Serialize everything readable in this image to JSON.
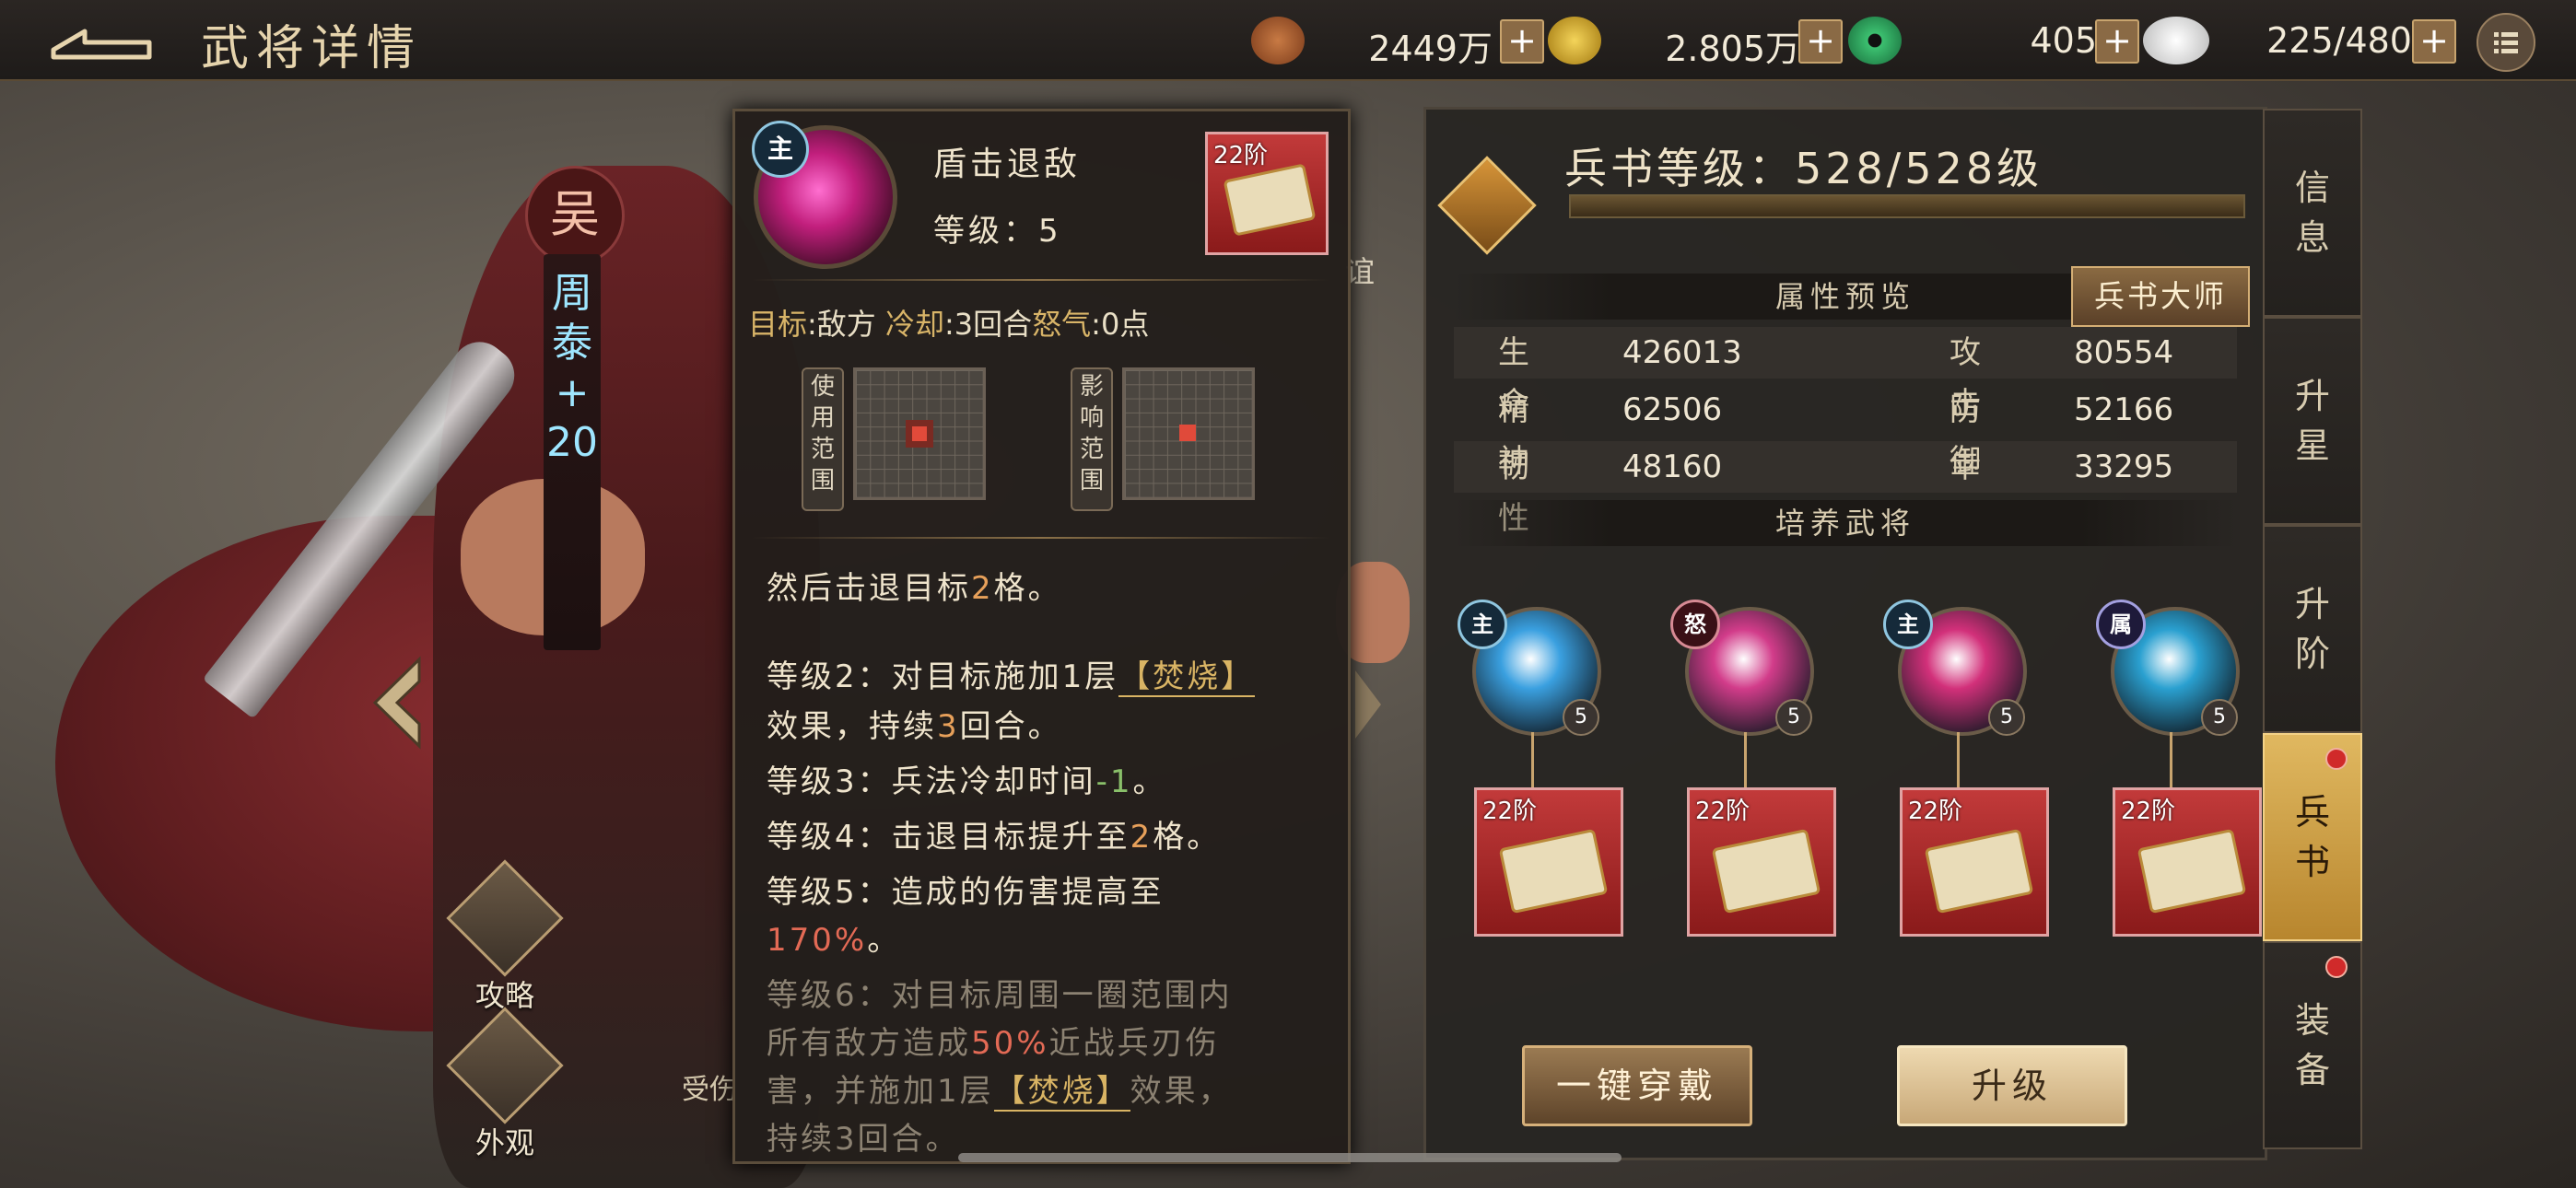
{
  "header": {
    "title": "武将详情",
    "resources": [
      {
        "icon": "copper-coin-icon",
        "value": "2449万"
      },
      {
        "icon": "gold-coin-icon",
        "value": "2.805万"
      },
      {
        "icon": "jade-icon",
        "value": "405"
      },
      {
        "icon": "steamed-bun-icon",
        "value": "225/480"
      }
    ],
    "plus_label": "+"
  },
  "hero": {
    "faction": "吴",
    "name_chars": [
      "周",
      "泰",
      "+",
      "20"
    ]
  },
  "side_buttons": [
    {
      "label": "攻略"
    },
    {
      "label": "外观"
    }
  ],
  "behind_text": {
    "right_partial": "谊",
    "bottom_partial": "受伤"
  },
  "skill": {
    "tag": "主",
    "name": "盾击退敌",
    "level_text": "等级：5",
    "tier": "22阶",
    "info_target_k": "目标",
    "info_target_v": ":敌方",
    "info_cd_k": "冷却",
    "info_cd_v": ":3回合",
    "info_rage_k": "怒气",
    "info_rage_v": ":0点",
    "use_range_label": [
      "使",
      "用",
      "范",
      "围"
    ],
    "effect_range_label": [
      "影",
      "响",
      "范",
      "围"
    ],
    "desc": [
      {
        "a": "然后击退目标",
        "b": "2",
        "c": "格。"
      },
      {
        "a": "等级2：对目标施加1层",
        "tag": "【焚烧】"
      },
      {
        "a": "效果，持续",
        "b": "3",
        "c": "回合。"
      },
      {
        "a": "等级3：兵法冷却时间",
        "b": "-1",
        "c": "。"
      },
      {
        "a": "等级4：击退目标提升至",
        "b": "2",
        "c": "格。"
      },
      {
        "a": "等级5：造成的伤害提高至"
      },
      {
        "a": "170%",
        "c": "。"
      },
      {
        "a": "等级6：对目标周围一圈范围内"
      },
      {
        "a": "所有敌方造成",
        "b": "50%",
        "c": "近战兵刃伤"
      },
      {
        "a": "害，并施加1层",
        "tag": "【焚烧】",
        "c": "效果，"
      },
      {
        "a": "持续3回合。"
      }
    ]
  },
  "book": {
    "level_text": "兵书等级：528/528级",
    "level_progress": 1.0,
    "attr_header": "属性预览",
    "master_button": "兵书大师",
    "stats": [
      {
        "name": "生命",
        "value": "426013"
      },
      {
        "name": "攻击",
        "value": "80554"
      },
      {
        "name": "精神",
        "value": "62506"
      },
      {
        "name": "防御",
        "value": "52166"
      },
      {
        "name": "韧性",
        "value": "48160"
      },
      {
        "name": "幸运",
        "value": "33295"
      }
    ],
    "train_header": "培养武将",
    "generals": [
      {
        "tag": "主",
        "level": "5",
        "tier": "22阶",
        "orb_color": "#3aa0e0"
      },
      {
        "tag": "怒",
        "level": "5",
        "tier": "22阶",
        "orb_color": "#d23c8a"
      },
      {
        "tag": "主",
        "level": "5",
        "tier": "22阶",
        "orb_color": "#d2307a"
      },
      {
        "tag": "属",
        "level": "5",
        "tier": "22阶",
        "orb_color": "#2aa0d0"
      }
    ],
    "wear_button": "一键穿戴",
    "upgrade_button": "升级"
  },
  "tabs": [
    {
      "label": "信息",
      "active": false,
      "dot": false
    },
    {
      "label": "升星",
      "active": false,
      "dot": false
    },
    {
      "label": "升阶",
      "active": false,
      "dot": false
    },
    {
      "label": "兵书",
      "active": true,
      "dot": true
    },
    {
      "label": "装备",
      "active": false,
      "dot": true
    }
  ]
}
